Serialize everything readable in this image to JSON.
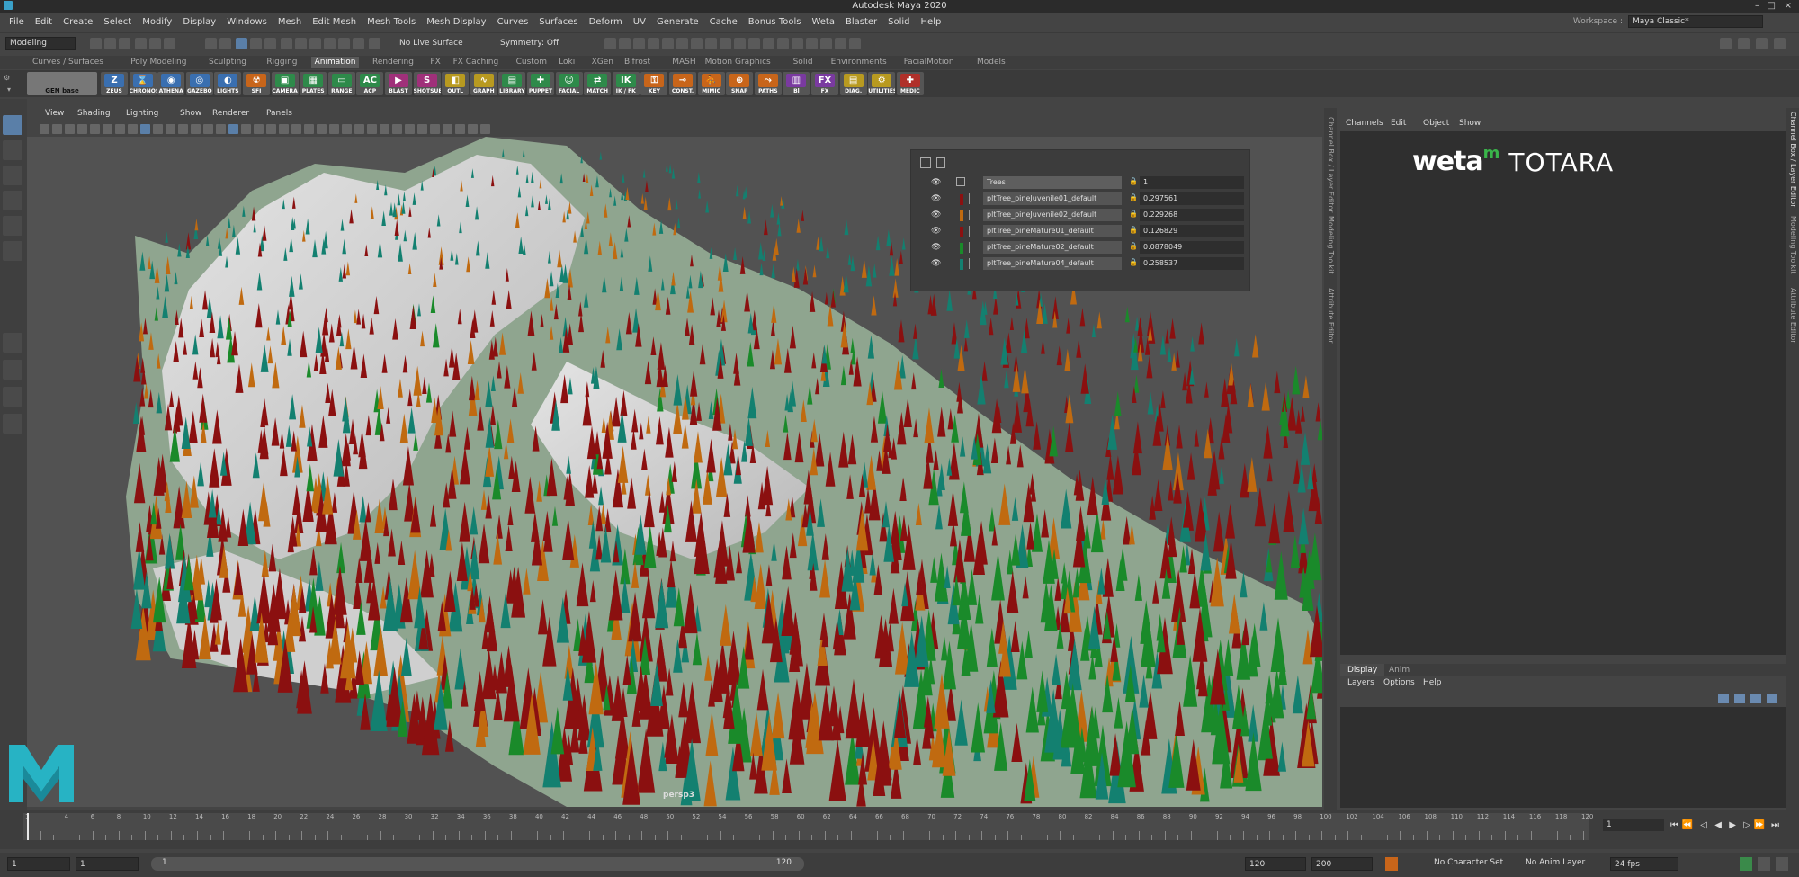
{
  "window": {
    "title": "Autodesk Maya 2020",
    "controls": [
      "–",
      "□",
      "×"
    ]
  },
  "menus": [
    "File",
    "Edit",
    "Create",
    "Select",
    "Modify",
    "Display",
    "Windows",
    "Mesh",
    "Edit Mesh",
    "Mesh Tools",
    "Mesh Display",
    "Curves",
    "Surfaces",
    "Deform",
    "UV",
    "Generate",
    "Cache",
    "Bonus Tools",
    "Weta",
    "Blaster",
    "Solid",
    "Help"
  ],
  "workspace": {
    "label": "Workspace :",
    "value": "Maya Classic*"
  },
  "statusline": {
    "mode": "Modeling",
    "live_surface": "No Live Surface",
    "symmetry": "Symmetry: Off"
  },
  "shelf_tabs": [
    "Curves / Surfaces",
    "Poly Modeling",
    "Sculpting",
    "Rigging",
    "Animation",
    "Rendering",
    "FX",
    "FX Caching",
    "Custom",
    "Loki",
    "XGen",
    "Bifrost",
    "MASH",
    "Motion Graphics",
    "Solid",
    "Environments",
    "FacialMotion",
    "Models"
  ],
  "shelf_active_tab": "Animation",
  "shelf_gen_base": "GEN base",
  "shelf_buttons": [
    {
      "label": "ZEUS",
      "glyph": "Z",
      "color": "#3a6fb0"
    },
    {
      "label": "CHRONOS",
      "glyph": "⌛",
      "color": "#3a6fb0"
    },
    {
      "label": "ATHENA",
      "glyph": "◉",
      "color": "#3a6fb0"
    },
    {
      "label": "GAZEBO",
      "glyph": "◎",
      "color": "#3a6fb0"
    },
    {
      "label": "LIGHTS",
      "glyph": "◐",
      "color": "#3a6fb0"
    },
    {
      "label": "SFI",
      "glyph": "☢",
      "color": "#c8651a"
    },
    {
      "label": "CAMERA",
      "glyph": "▣",
      "color": "#2e8a4a"
    },
    {
      "label": "PLATES",
      "glyph": "▦",
      "color": "#2e8a4a"
    },
    {
      "label": "RANGE",
      "glyph": "▭",
      "color": "#2e8a4a"
    },
    {
      "label": "ACP",
      "glyph": "AC",
      "color": "#2e8a4a"
    },
    {
      "label": "BLAST",
      "glyph": "▶",
      "color": "#a0307a"
    },
    {
      "label": "SHOTSUB",
      "glyph": "S",
      "color": "#a0307a"
    },
    {
      "label": "OUTL",
      "glyph": "◧",
      "color": "#b89a20"
    },
    {
      "label": "GRAPH",
      "glyph": "∿",
      "color": "#b89a20"
    },
    {
      "label": "LIBRARY",
      "glyph": "▤",
      "color": "#2e8a4a"
    },
    {
      "label": "PUPPET",
      "glyph": "✚",
      "color": "#2e8a4a"
    },
    {
      "label": "FACIAL",
      "glyph": "☺",
      "color": "#2e8a4a"
    },
    {
      "label": "MATCH",
      "glyph": "⇄",
      "color": "#2e8a4a"
    },
    {
      "label": "IK / FK",
      "glyph": "IK",
      "color": "#2e8a4a"
    },
    {
      "label": "KEY",
      "glyph": "⚿",
      "color": "#c8651a"
    },
    {
      "label": "CONST.",
      "glyph": "⊸",
      "color": "#c8651a"
    },
    {
      "label": "MIMIC",
      "glyph": "⛹",
      "color": "#c8651a"
    },
    {
      "label": "SNAP",
      "glyph": "⊕",
      "color": "#c8651a"
    },
    {
      "label": "PATHS",
      "glyph": "⤳",
      "color": "#c8651a"
    },
    {
      "label": "Bl",
      "glyph": "▥",
      "color": "#7a3aa0"
    },
    {
      "label": "FX",
      "glyph": "FX",
      "color": "#7a3aa0"
    },
    {
      "label": "DIAG.",
      "glyph": "▤",
      "color": "#b89a20"
    },
    {
      "label": "UTILITIES",
      "glyph": "⚙",
      "color": "#b89a20"
    },
    {
      "label": "MEDIC",
      "glyph": "✚",
      "color": "#b0302a"
    }
  ],
  "viewport_menu": [
    "View",
    "Shading",
    "Lighting",
    "Show",
    "Renderer",
    "Panels"
  ],
  "viewport_camera": "persp3",
  "layer_panel": {
    "header_name": "Trees",
    "header_value": "1",
    "rows": [
      {
        "name": "pltTree_pineJuvenile01_default",
        "value": "0.297561",
        "color": "#8b1010"
      },
      {
        "name": "pltTree_pineJuvenile02_default",
        "value": "0.229268",
        "color": "#c06a10"
      },
      {
        "name": "pltTree_pineMature01_default",
        "value": "0.126829",
        "color": "#8b1010"
      },
      {
        "name": "pltTree_pineMature02_default",
        "value": "0.0878049",
        "color": "#1a8a2a"
      },
      {
        "name": "pltTree_pineMature04_default",
        "value": "0.258537",
        "color": "#138070"
      }
    ]
  },
  "side_labels": [
    "Channel Box / Layer Editor",
    "Modeling Toolkit",
    "Attribute Editor"
  ],
  "far_right_labels": [
    "Channel Box / Layer Editor",
    "Modeling Toolkit",
    "Attribute Editor"
  ],
  "channel_box": {
    "menus": [
      "Channels",
      "Edit",
      "Object",
      "Show"
    ]
  },
  "logo": {
    "weta": "weta",
    "m": "m",
    "totara": "TOTARA"
  },
  "layer_editor": {
    "tabs": [
      "Display",
      "Anim"
    ],
    "active_tab": "Display",
    "menus": [
      "Layers",
      "Options",
      "Help"
    ]
  },
  "timeline": {
    "ticks": [
      1,
      4,
      6,
      8,
      10,
      12,
      14,
      16,
      18,
      20,
      22,
      24,
      26,
      28,
      30,
      32,
      34,
      36,
      38,
      40,
      42,
      44,
      46,
      48,
      50,
      52,
      54,
      56,
      58,
      60,
      62,
      64,
      66,
      68,
      70,
      72,
      74,
      76,
      78,
      80,
      82,
      84,
      86,
      88,
      90,
      92,
      94,
      96,
      98,
      100,
      102,
      104,
      106,
      108,
      110,
      112,
      114,
      116,
      118,
      120
    ],
    "current_frame": "1"
  },
  "range": {
    "start": "1",
    "playback_start": "1",
    "slider_start": "1",
    "slider_end": "120",
    "playback_end": "120",
    "end": "200",
    "character_set": "No Character Set",
    "anim_layer": "No Anim Layer",
    "fps": "24 fps"
  },
  "colors": {
    "accent": "#5a7fa8",
    "tree_red": "#8b1010",
    "tree_teal": "#138070",
    "tree_green": "#1a8a2a",
    "tree_orange": "#c06a10",
    "snow": "#d8d8d8",
    "grass": "#8fa58f"
  }
}
